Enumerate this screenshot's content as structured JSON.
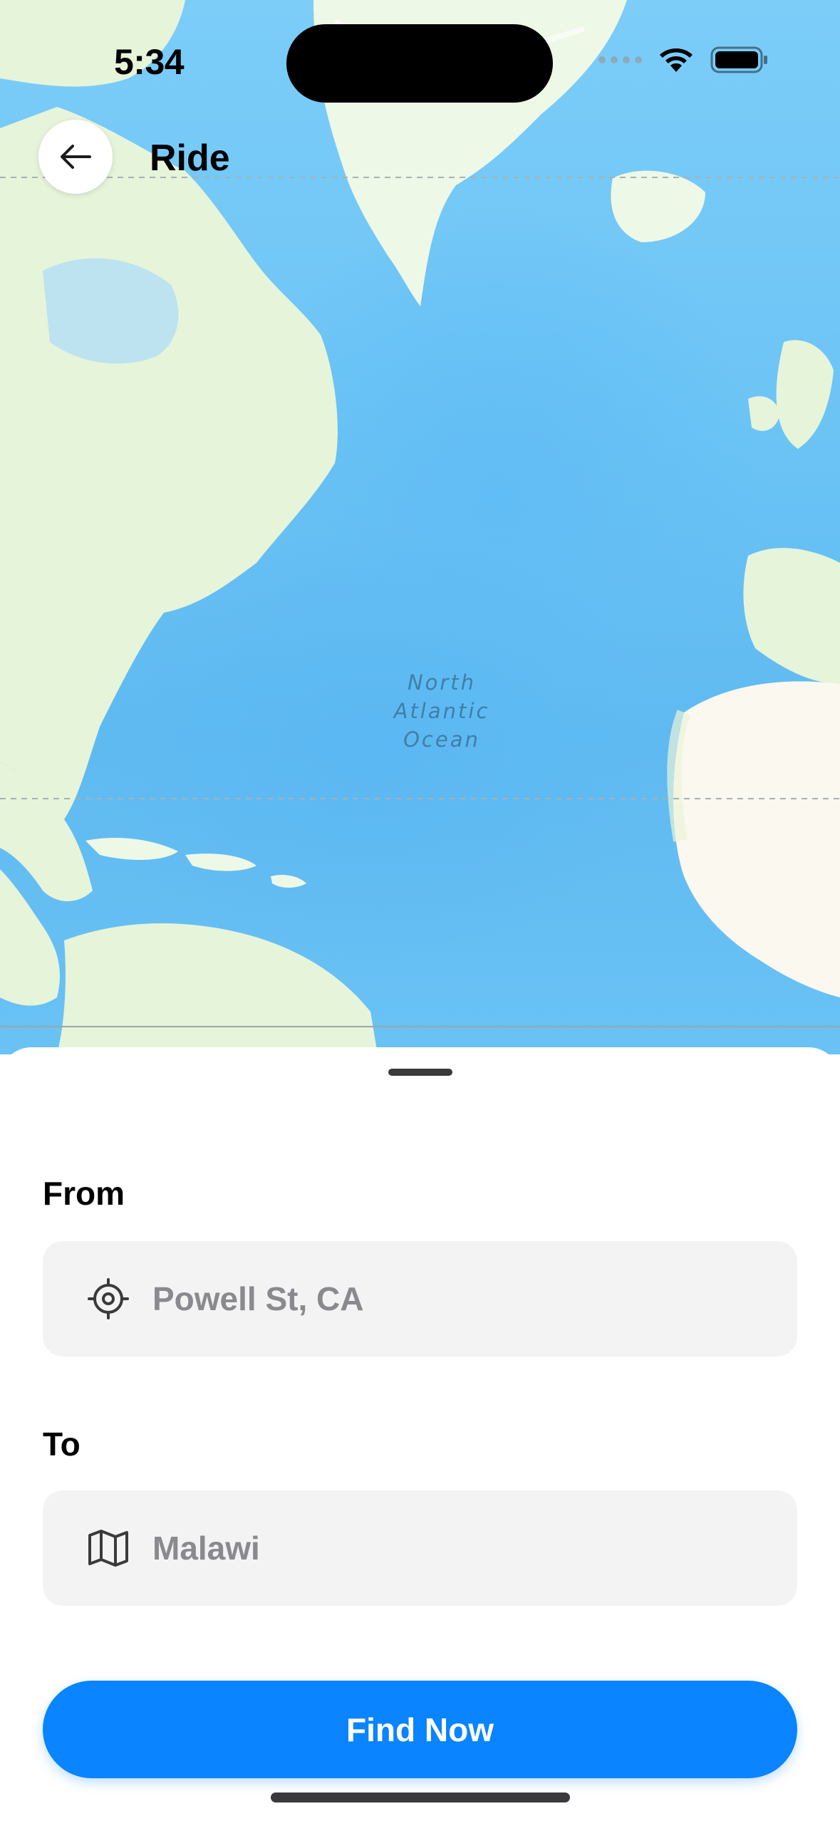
{
  "status_bar": {
    "time": "5:34"
  },
  "header": {
    "title": "Ride"
  },
  "map": {
    "ocean_label_lines": [
      "North",
      "Atlantic",
      "Ocean"
    ]
  },
  "form": {
    "from_label": "From",
    "from_value": "Powell St, CA",
    "to_label": "To",
    "to_value": "Malawi"
  },
  "actions": {
    "find_label": "Find Now"
  },
  "colors": {
    "accent": "#0a84ff",
    "field_bg": "#f3f3f3",
    "ocean": "#6cc4f5",
    "land": "#e8f5dc"
  },
  "icons": [
    "back-arrow-icon",
    "wifi-icon",
    "battery-icon",
    "location-crosshair-icon",
    "map-icon"
  ]
}
